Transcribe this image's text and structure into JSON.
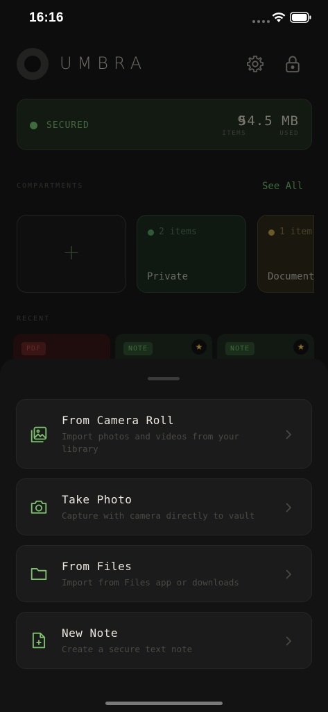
{
  "status": {
    "time": "16:16"
  },
  "app": {
    "title": "UMBRA"
  },
  "vault": {
    "state": "SECURED",
    "items_value": "9",
    "items_label": "ITEMS",
    "used_value": "54.5 MB",
    "used_label": "USED"
  },
  "compartments": {
    "label": "COMPARTMENTS",
    "see_all": "See All",
    "add_symbol": "+",
    "items": [
      {
        "name": "Private",
        "count": "2 items",
        "color": "#2f5a38"
      },
      {
        "name": "Documents",
        "count": "1 item",
        "color": "#6a5a28"
      }
    ]
  },
  "recent": {
    "label": "RECENT",
    "items": [
      {
        "type": "PDF"
      },
      {
        "type": "NOTE",
        "starred": "★"
      },
      {
        "type": "NOTE",
        "starred": "★"
      }
    ]
  },
  "sheet": {
    "options": [
      {
        "title": "From Camera Roll",
        "subtitle": "Import photos and videos from your library",
        "icon": "photo-library-icon"
      },
      {
        "title": "Take Photo",
        "subtitle": "Capture with camera directly to vault",
        "icon": "camera-icon"
      },
      {
        "title": "From Files",
        "subtitle": "Import from Files app or downloads",
        "icon": "folder-icon"
      },
      {
        "title": "New Note",
        "subtitle": "Create a secure text note",
        "icon": "new-note-icon"
      }
    ]
  },
  "colors": {
    "accent": "#7cc36e",
    "background": "#0b0b0b",
    "sheet": "#131313"
  }
}
